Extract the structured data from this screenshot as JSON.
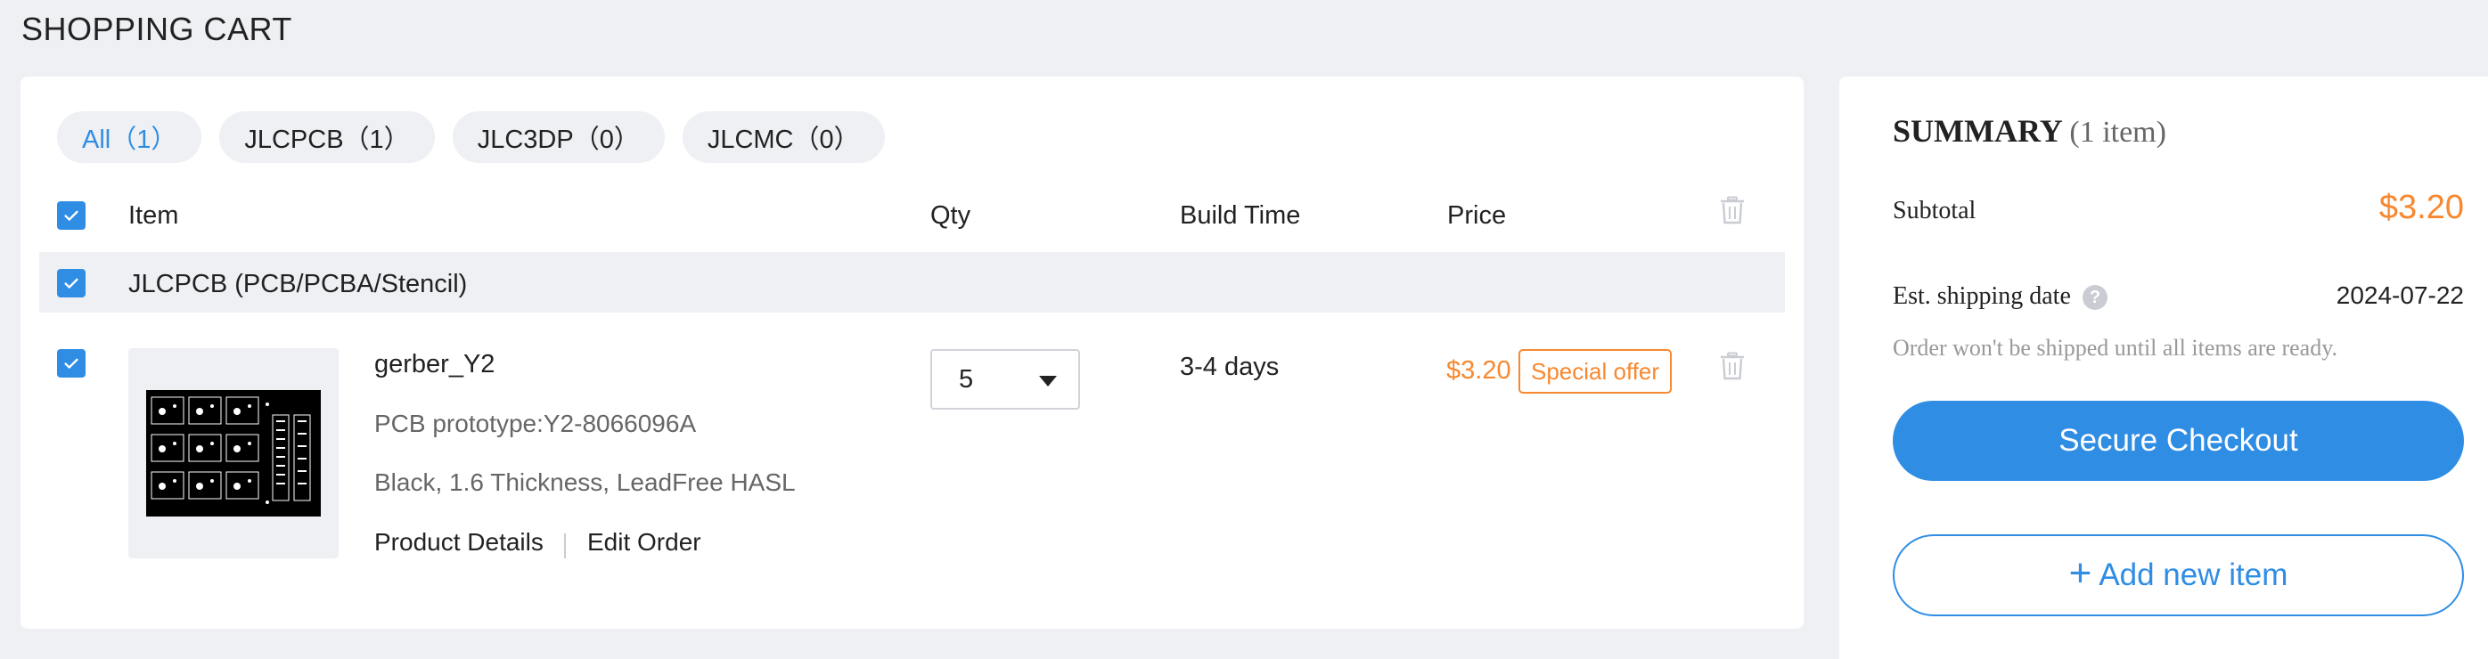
{
  "page": {
    "title": "SHOPPING CART"
  },
  "tabs": [
    {
      "label": "All（1）",
      "active": true
    },
    {
      "label": "JLCPCB（1）",
      "active": false
    },
    {
      "label": "JLC3DP（0）",
      "active": false
    },
    {
      "label": "JLCMC（0）",
      "active": false
    }
  ],
  "table": {
    "headers": {
      "item": "Item",
      "qty": "Qty",
      "build_time": "Build Time",
      "price": "Price"
    }
  },
  "group": {
    "label": "JLCPCB (PCB/PCBA/Stencil)"
  },
  "cart_item": {
    "name": "gerber_Y2",
    "spec1": "PCB prototype:Y2-8066096A",
    "spec2": "Black, 1.6 Thickness, LeadFree HASL",
    "details_link": "Product Details",
    "edit_link": "Edit Order",
    "qty": "5",
    "build_time": "3-4 days",
    "price": "$3.20",
    "badge": "Special offer"
  },
  "summary": {
    "title": "SUMMARY",
    "count": "(1 item)",
    "subtotal_label": "Subtotal",
    "subtotal_value": "$3.20",
    "ship_label": "Est. shipping date",
    "ship_value": "2024-07-22",
    "help_glyph": "?",
    "note": "Order won't be shipped until all items are ready.",
    "checkout_label": "Secure Checkout",
    "add_icon": "+",
    "add_label": "Add new item"
  },
  "colors": {
    "accent": "#2f8de4",
    "price": "#f7882f",
    "page_bg": "#eef0f4"
  },
  "icons": [
    "check-icon",
    "trash-icon",
    "chevron-down-icon",
    "question-icon",
    "plus-icon"
  ]
}
